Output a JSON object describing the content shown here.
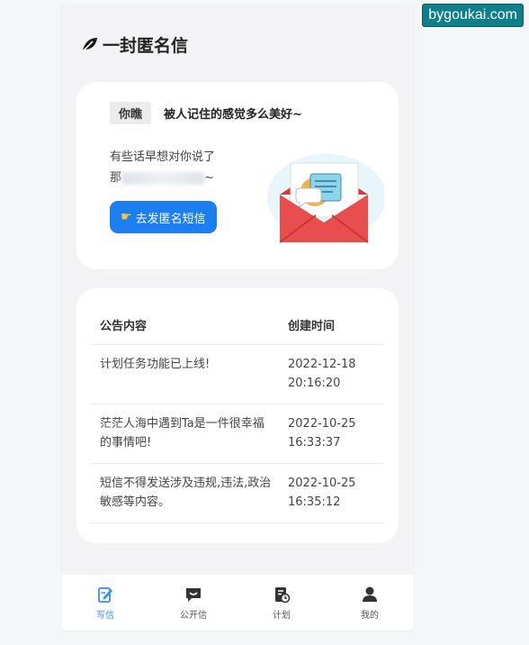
{
  "watermark": "bygoukai.com",
  "app": {
    "title": "一封匿名信",
    "logo_icon": "leaf-icon"
  },
  "hero": {
    "tag": "你瞧",
    "tagline": "被人记住的感觉多么美好~",
    "desc_line1": "有些话早想对你说了",
    "desc_line2_start": "那",
    "desc_line2_end": "~",
    "button_label": "去发匿名短信",
    "button_icon": "pointing-hand-icon",
    "illustration": "envelope-letter-icon"
  },
  "notices": {
    "headers": {
      "content": "公告内容",
      "time": "创建时间"
    },
    "rows": [
      {
        "content": "计划任务功能已上线!",
        "date": "2022-12-18",
        "time": "20:16:20"
      },
      {
        "content": "茫茫人海中遇到Ta是一件很幸福的事情吧!",
        "date": "2022-10-25",
        "time": "16:33:37"
      },
      {
        "content": "短信不得发送涉及违规,违法,政治敏感等内容。",
        "date": "2022-10-25",
        "time": "16:35:12"
      }
    ]
  },
  "tabbar": {
    "active_color": "#3b8cf0",
    "tabs": [
      {
        "label": "写信",
        "icon": "write-icon",
        "active": true
      },
      {
        "label": "公开信",
        "icon": "message-icon",
        "active": false
      },
      {
        "label": "计划",
        "icon": "plan-icon",
        "active": false
      },
      {
        "label": "我的",
        "icon": "user-icon",
        "active": false
      }
    ]
  },
  "colors": {
    "primary_button": "#1d7ef2",
    "envelope": "#e94e4e"
  }
}
